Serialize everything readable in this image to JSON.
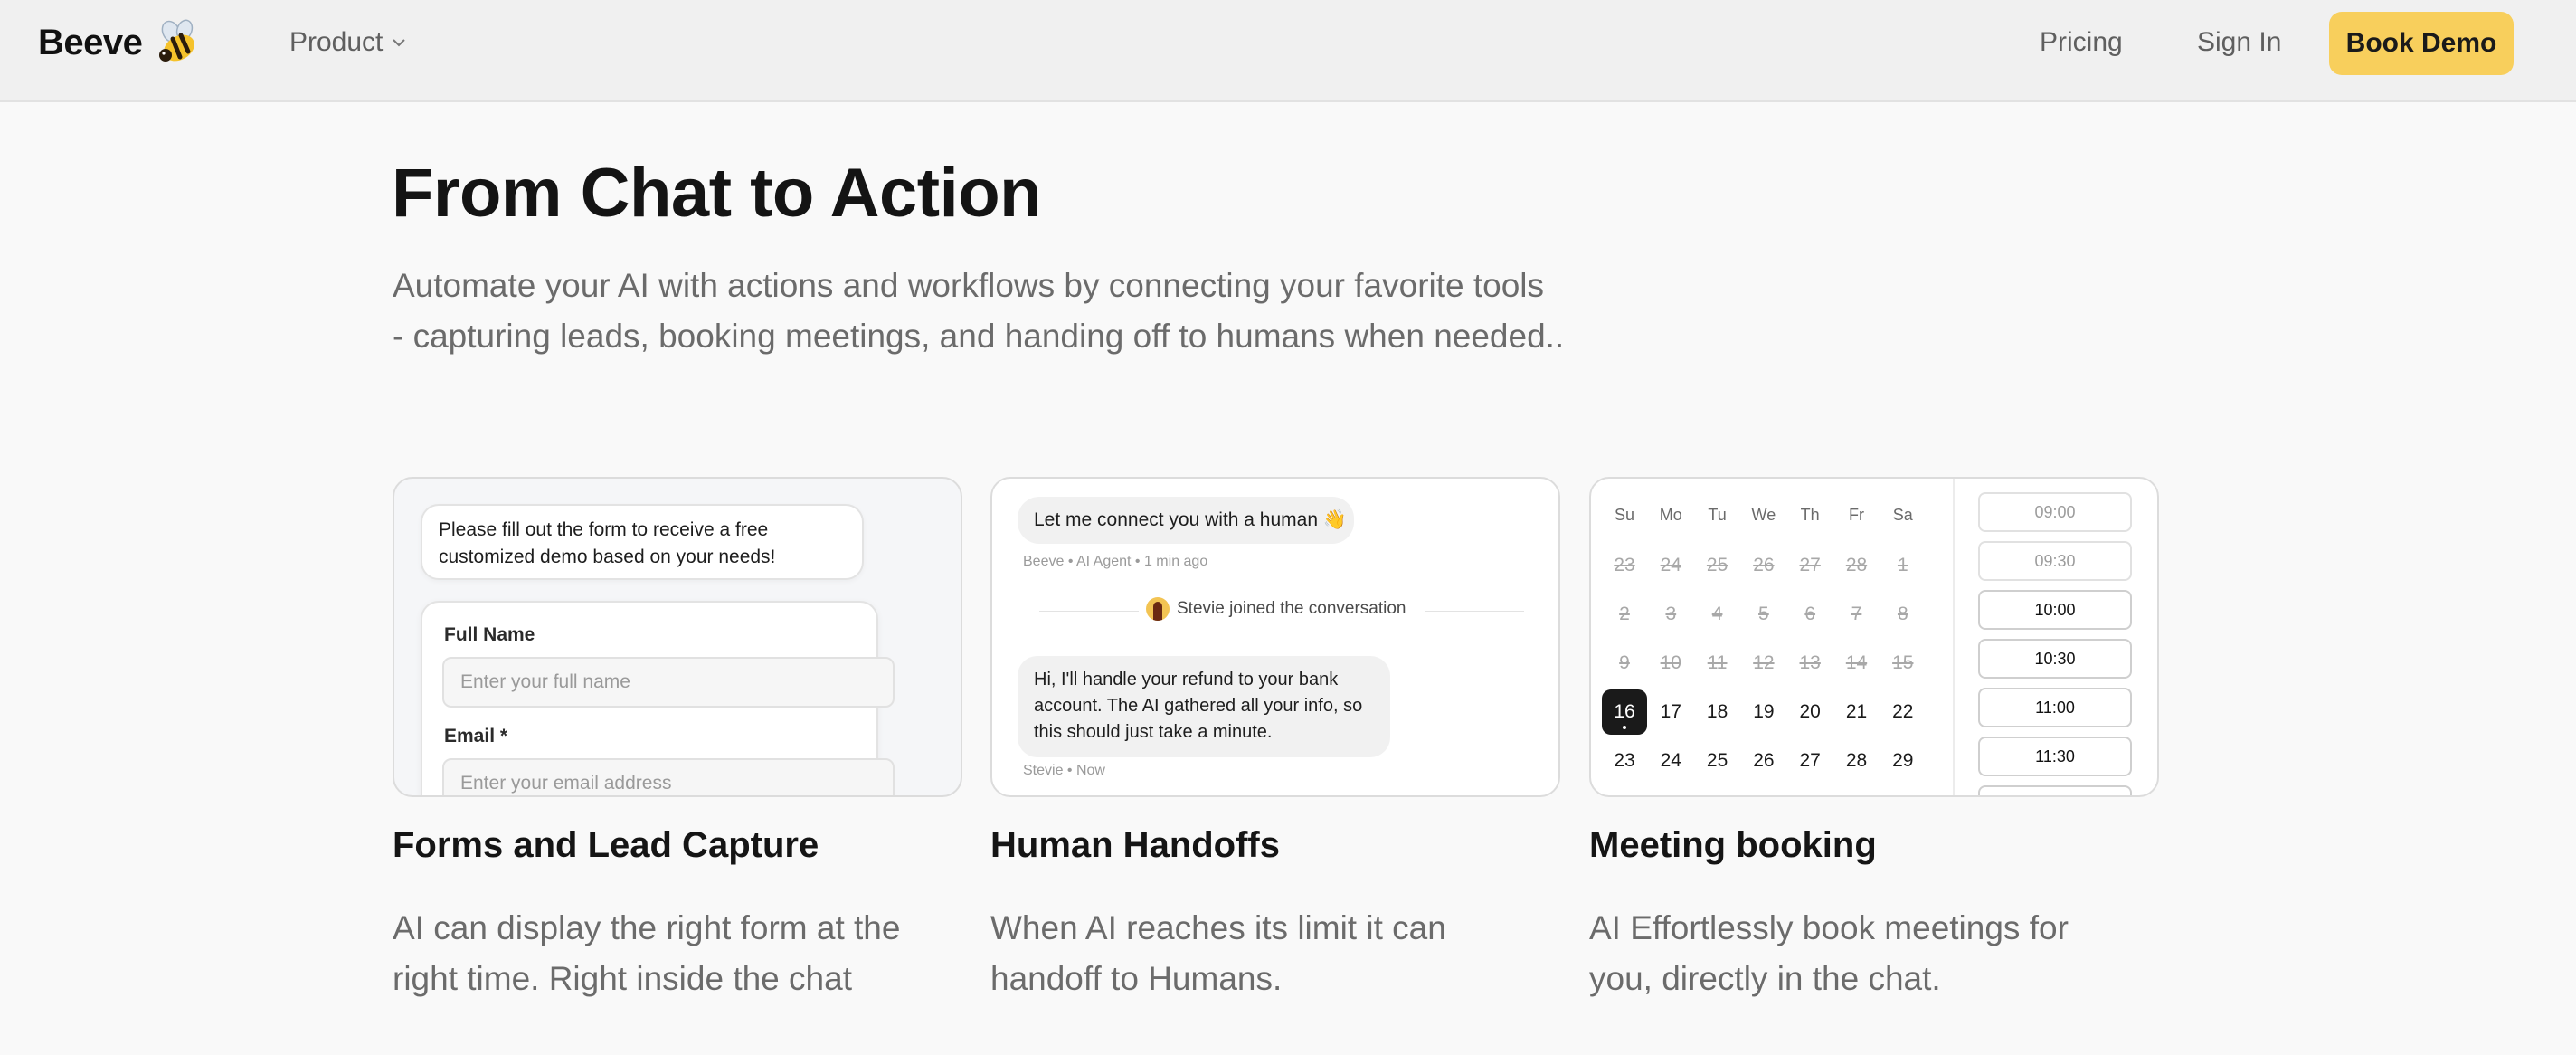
{
  "nav": {
    "brand": "Beeve",
    "product_label": "Product",
    "pricing_label": "Pricing",
    "signin_label": "Sign In",
    "demo_label": "Book Demo",
    "accent": "#f8cf5c"
  },
  "hero": {
    "title": "From Chat to Action",
    "subtitle_line1": "Automate your AI with actions and workflows by connecting your favorite tools",
    "subtitle_line2": "- capturing leads, booking meetings, and handing off to humans when needed.."
  },
  "features": [
    {
      "title": "Forms and Lead Capture",
      "desc_line1": "AI can display the right form at the",
      "desc_line2": "right time. Right inside the chat",
      "bubble_line1": "Please fill out the form to receive a free",
      "bubble_line2": "customized demo based on your needs!",
      "fields": [
        {
          "label": "Full Name",
          "placeholder": "Enter your full name"
        },
        {
          "label": "Email *",
          "placeholder": "Enter your email address"
        }
      ]
    },
    {
      "title": "Human Handoffs",
      "desc_line1": "When AI reaches its limit it can",
      "desc_line2": "handoff to Humans.",
      "message1": "Let me connect you with a human 👋",
      "meta1": "Beeve • AI Agent • 1 min ago",
      "joined": "Stevie joined the conversation",
      "message2_line1": "Hi, I'll handle your refund to your bank",
      "message2_line2": "account. The AI gathered all your info, so",
      "message2_line3": "this should just take a minute.",
      "meta2": "Stevie • Now"
    },
    {
      "title": "Meeting booking",
      "desc_line1": "AI Effortlessly book meetings for",
      "desc_line2": "you, directly in the chat.",
      "weekdays": [
        "Su",
        "Mo",
        "Tu",
        "We",
        "Th",
        "Fr",
        "Sa"
      ],
      "weeks": [
        [
          "23",
          "24",
          "25",
          "26",
          "27",
          "28",
          "1"
        ],
        [
          "2",
          "3",
          "4",
          "5",
          "6",
          "7",
          "8"
        ],
        [
          "9",
          "10",
          "11",
          "12",
          "13",
          "14",
          "15"
        ],
        [
          "16",
          "17",
          "18",
          "19",
          "20",
          "21",
          "22"
        ],
        [
          "23",
          "24",
          "25",
          "26",
          "27",
          "28",
          "29"
        ]
      ],
      "selected_day": "16",
      "time_slots": [
        "09:00",
        "09:30",
        "10:00",
        "10:30",
        "11:00",
        "11:30"
      ],
      "unavailable_slots": [
        "09:00",
        "09:30"
      ]
    }
  ]
}
